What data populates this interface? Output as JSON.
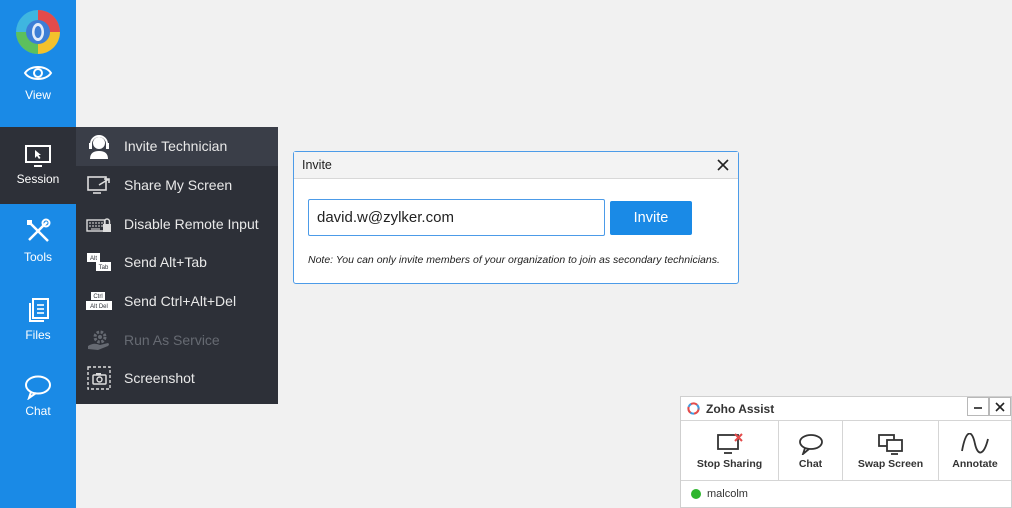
{
  "rail": {
    "items": [
      {
        "label": "View",
        "icon": "eye-icon"
      },
      {
        "label": "Session",
        "icon": "monitor-cursor-icon"
      },
      {
        "label": "Tools",
        "icon": "tools-icon"
      },
      {
        "label": "Files",
        "icon": "files-icon"
      },
      {
        "label": "Chat",
        "icon": "chat-bubble-icon"
      }
    ],
    "active": "Session"
  },
  "session_menu": {
    "items": [
      {
        "label": "Invite Technician",
        "icon": "headset-user-icon",
        "state": "active"
      },
      {
        "label": "Share My Screen",
        "icon": "share-screen-icon",
        "state": "enabled"
      },
      {
        "label": "Disable Remote Input",
        "icon": "keyboard-lock-icon",
        "state": "enabled"
      },
      {
        "label": "Send Alt+Tab",
        "icon": "alt-tab-keys-icon",
        "key_top": "Alt",
        "key_bottom": "Tab",
        "state": "enabled"
      },
      {
        "label": "Send Ctrl+Alt+Del",
        "icon": "ctrl-alt-del-keys-icon",
        "key_top": "Ctrl",
        "key_bottom": "Alt Del",
        "state": "enabled"
      },
      {
        "label": "Run As Service",
        "icon": "gear-hand-icon",
        "state": "disabled"
      },
      {
        "label": "Screenshot",
        "icon": "camera-frame-icon",
        "state": "enabled"
      }
    ]
  },
  "invite_dialog": {
    "title": "Invite",
    "email_value": "david.w@zylker.com",
    "invite_label": "Invite",
    "note": "Note: You can only invite members of your organization to join as secondary technicians."
  },
  "widget": {
    "title": "Zoho Assist",
    "actions": [
      {
        "label": "Stop Sharing",
        "icon": "stop-sharing-icon"
      },
      {
        "label": "Chat",
        "icon": "chat-bubble-icon"
      },
      {
        "label": "Swap Screen",
        "icon": "swap-screen-icon"
      },
      {
        "label": "Annotate",
        "icon": "annotate-wave-icon"
      }
    ],
    "user": "malcolm",
    "user_status_color": "#2cb52c"
  },
  "colors": {
    "accent": "#1a8ae6",
    "menu_bg": "#2d3038"
  }
}
